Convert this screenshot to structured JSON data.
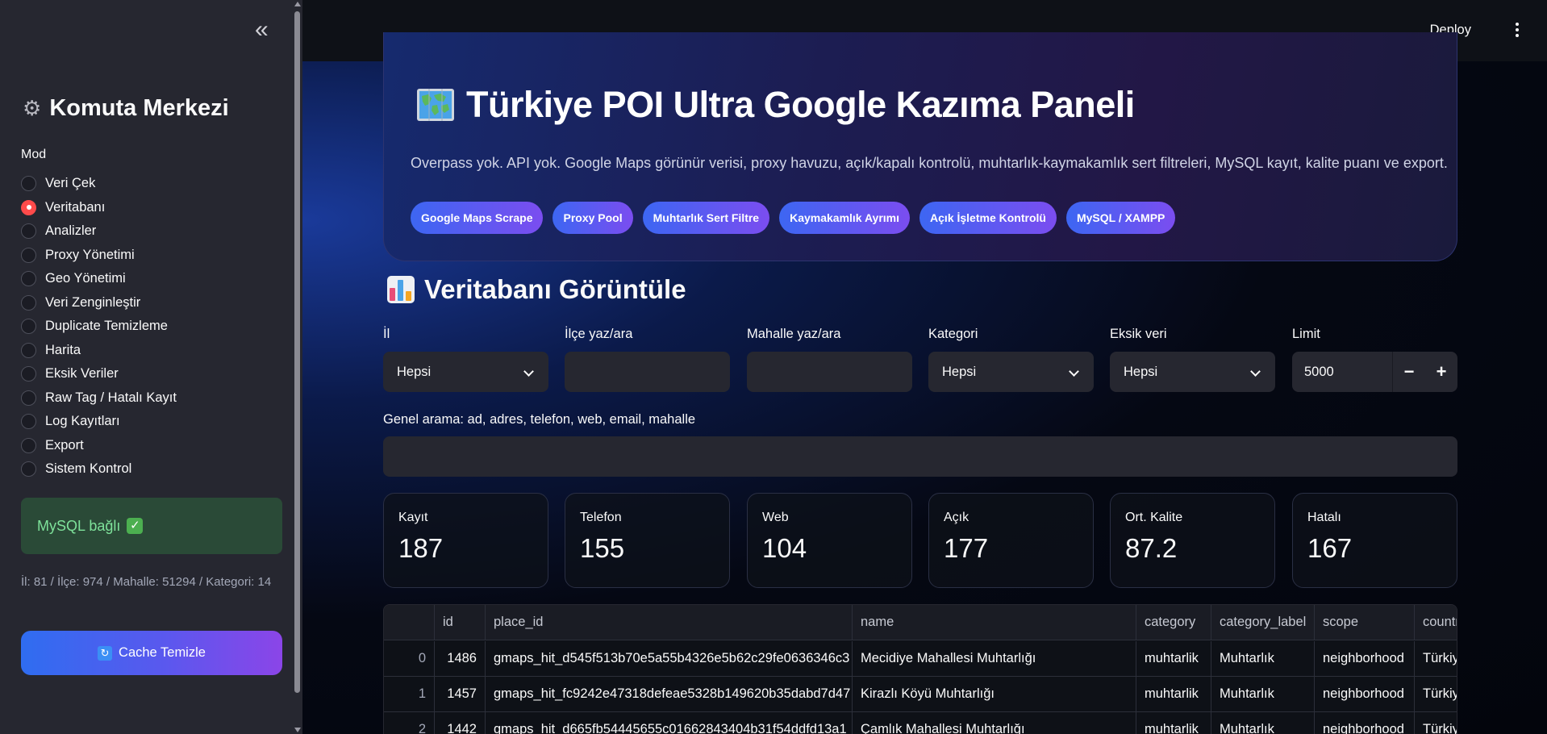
{
  "sidebar": {
    "title": "Komuta Merkezi",
    "mode_label": "Mod",
    "modes": [
      {
        "label": "Veri Çek",
        "selected": false
      },
      {
        "label": "Veritabanı",
        "selected": true
      },
      {
        "label": "Analizler",
        "selected": false
      },
      {
        "label": "Proxy Yönetimi",
        "selected": false
      },
      {
        "label": "Geo Yönetimi",
        "selected": false
      },
      {
        "label": "Veri Zenginleştir",
        "selected": false
      },
      {
        "label": "Duplicate Temizleme",
        "selected": false
      },
      {
        "label": "Harita",
        "selected": false
      },
      {
        "label": "Eksik Veriler",
        "selected": false
      },
      {
        "label": "Raw Tag / Hatalı Kayıt",
        "selected": false
      },
      {
        "label": "Log Kayıtları",
        "selected": false
      },
      {
        "label": "Export",
        "selected": false
      },
      {
        "label": "Sistem Kontrol",
        "selected": false
      }
    ],
    "mysql_status": "MySQL bağlı",
    "stats": "İl: 81 / İlçe: 974 / Mahalle: 51294 / Kategori: 14",
    "cache_button": "Cache Temizle"
  },
  "header": {
    "deploy_label": "Deploy"
  },
  "hero": {
    "title": "Türkiye POI Ultra Google Kazıma Paneli",
    "subtitle": "Overpass yok. API yok. Google Maps görünür verisi, proxy havuzu, açık/kapalı kontrolü, muhtarlık-kaymakamlık sert filtreleri, MySQL kayıt, kalite puanı ve export.",
    "pills": [
      "Google Maps Scrape",
      "Proxy Pool",
      "Muhtarlık Sert Filtre",
      "Kaymakamlık Ayrımı",
      "Açık İşletme Kontrolü",
      "MySQL / XAMPP"
    ]
  },
  "section": {
    "title": "Veritabanı Görüntüle"
  },
  "filters": {
    "il_label": "İl",
    "il_value": "Hepsi",
    "ilce_label": "İlçe yaz/ara",
    "ilce_value": "",
    "mahalle_label": "Mahalle yaz/ara",
    "mahalle_value": "",
    "kategori_label": "Kategori",
    "kategori_value": "Hepsi",
    "eksik_label": "Eksik veri",
    "eksik_value": "Hepsi",
    "limit_label": "Limit",
    "limit_value": "5000",
    "search_label": "Genel arama: ad, adres, telefon, web, email, mahalle",
    "search_value": ""
  },
  "metrics": [
    {
      "label": "Kayıt",
      "value": "187"
    },
    {
      "label": "Telefon",
      "value": "155"
    },
    {
      "label": "Web",
      "value": "104"
    },
    {
      "label": "Açık",
      "value": "177"
    },
    {
      "label": "Ort. Kalite",
      "value": "87.2"
    },
    {
      "label": "Hatalı",
      "value": "167"
    }
  ],
  "table": {
    "columns": [
      "",
      "id",
      "place_id",
      "name",
      "category",
      "category_label",
      "scope",
      "country"
    ],
    "rows": [
      [
        "0",
        "1486",
        "gmaps_hit_d545f513b70e5a55b4326e5b62c29fe0636346c3",
        "Mecidiye Mahallesi Muhtarlığı",
        "muhtarlik",
        "Muhtarlık",
        "neighborhood",
        "Türkiye"
      ],
      [
        "1",
        "1457",
        "gmaps_hit_fc9242e47318defeae5328b149620b35dabd7d47",
        "Kirazlı Köyü Muhtarlığı",
        "muhtarlik",
        "Muhtarlık",
        "neighborhood",
        "Türkiye"
      ],
      [
        "2",
        "1442",
        "gmaps_hit_d665fb54445655c01662843404b31f54ddfd13a1",
        "Çamlık Mahallesi Muhtarlığı",
        "muhtarlik",
        "Muhtarlık",
        "neighborhood",
        "Türkiye"
      ]
    ]
  },
  "colors": {
    "accent_radio": "#ff4b4b",
    "pill_gradient_start": "#3d66f2",
    "pill_gradient_end": "#7b4df0",
    "success_text": "#7ee29a"
  },
  "icons": {
    "sidebar_title_icon": "gear-icon",
    "hero_icon": "world-map-icon",
    "section_icon": "bar-chart-icon",
    "mysql_icon": "check-mark-icon",
    "cache_icon": "refresh-icon"
  }
}
